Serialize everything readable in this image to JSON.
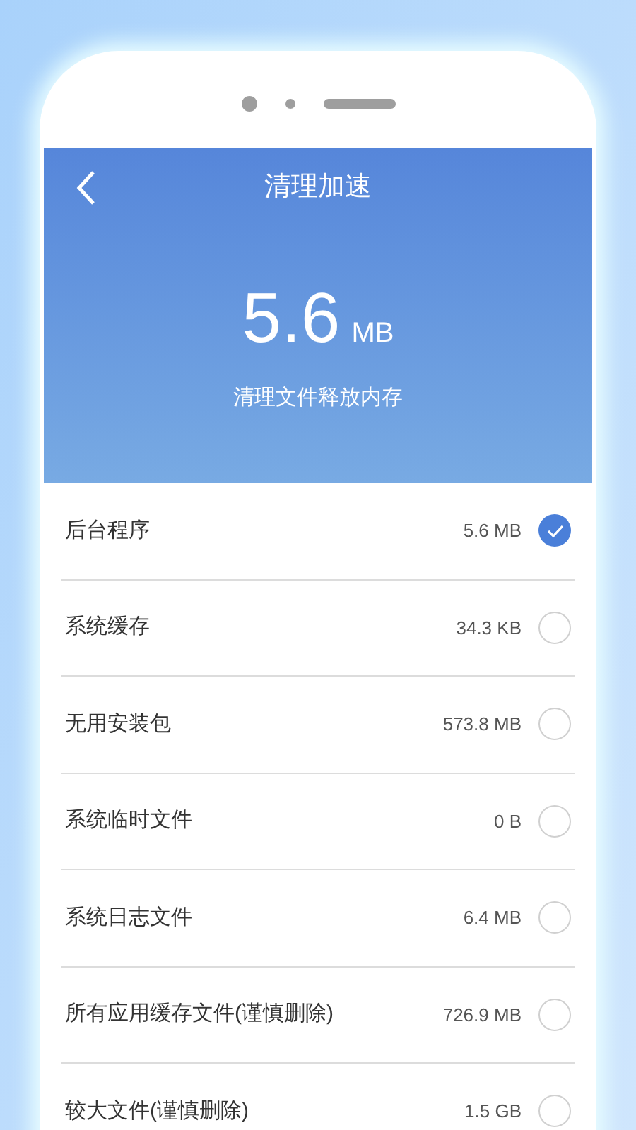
{
  "header": {
    "title": "清理加速",
    "amount": "5.6",
    "unit": "MB",
    "subtitle": "清理文件释放内存"
  },
  "items": [
    {
      "label": "后台程序",
      "size": "5.6 MB",
      "checked": true
    },
    {
      "label": "系统缓存",
      "size": "34.3 KB",
      "checked": false
    },
    {
      "label": "无用安装包",
      "size": "573.8 MB",
      "checked": false
    },
    {
      "label": "系统临时文件",
      "size": "0 B",
      "checked": false
    },
    {
      "label": "系统日志文件",
      "size": "6.4 MB",
      "checked": false
    },
    {
      "label": "所有应用缓存文件(谨慎删除)",
      "size": "726.9 MB",
      "checked": false
    },
    {
      "label": "较大文件(谨慎删除)",
      "size": "1.5 GB",
      "checked": false
    }
  ]
}
